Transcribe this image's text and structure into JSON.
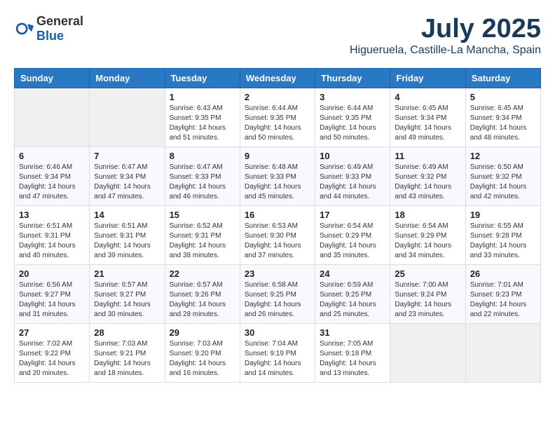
{
  "logo": {
    "text_general": "General",
    "text_blue": "Blue"
  },
  "header": {
    "month_year": "July 2025",
    "location": "Higueruela, Castille-La Mancha, Spain"
  },
  "weekdays": [
    "Sunday",
    "Monday",
    "Tuesday",
    "Wednesday",
    "Thursday",
    "Friday",
    "Saturday"
  ],
  "weeks": [
    [
      {
        "day": "",
        "sunrise": "",
        "sunset": "",
        "daylight": ""
      },
      {
        "day": "",
        "sunrise": "",
        "sunset": "",
        "daylight": ""
      },
      {
        "day": "1",
        "sunrise": "Sunrise: 6:43 AM",
        "sunset": "Sunset: 9:35 PM",
        "daylight": "Daylight: 14 hours and 51 minutes."
      },
      {
        "day": "2",
        "sunrise": "Sunrise: 6:44 AM",
        "sunset": "Sunset: 9:35 PM",
        "daylight": "Daylight: 14 hours and 50 minutes."
      },
      {
        "day": "3",
        "sunrise": "Sunrise: 6:44 AM",
        "sunset": "Sunset: 9:35 PM",
        "daylight": "Daylight: 14 hours and 50 minutes."
      },
      {
        "day": "4",
        "sunrise": "Sunrise: 6:45 AM",
        "sunset": "Sunset: 9:34 PM",
        "daylight": "Daylight: 14 hours and 49 minutes."
      },
      {
        "day": "5",
        "sunrise": "Sunrise: 6:45 AM",
        "sunset": "Sunset: 9:34 PM",
        "daylight": "Daylight: 14 hours and 48 minutes."
      }
    ],
    [
      {
        "day": "6",
        "sunrise": "Sunrise: 6:46 AM",
        "sunset": "Sunset: 9:34 PM",
        "daylight": "Daylight: 14 hours and 47 minutes."
      },
      {
        "day": "7",
        "sunrise": "Sunrise: 6:47 AM",
        "sunset": "Sunset: 9:34 PM",
        "daylight": "Daylight: 14 hours and 47 minutes."
      },
      {
        "day": "8",
        "sunrise": "Sunrise: 6:47 AM",
        "sunset": "Sunset: 9:33 PM",
        "daylight": "Daylight: 14 hours and 46 minutes."
      },
      {
        "day": "9",
        "sunrise": "Sunrise: 6:48 AM",
        "sunset": "Sunset: 9:33 PM",
        "daylight": "Daylight: 14 hours and 45 minutes."
      },
      {
        "day": "10",
        "sunrise": "Sunrise: 6:49 AM",
        "sunset": "Sunset: 9:33 PM",
        "daylight": "Daylight: 14 hours and 44 minutes."
      },
      {
        "day": "11",
        "sunrise": "Sunrise: 6:49 AM",
        "sunset": "Sunset: 9:32 PM",
        "daylight": "Daylight: 14 hours and 43 minutes."
      },
      {
        "day": "12",
        "sunrise": "Sunrise: 6:50 AM",
        "sunset": "Sunset: 9:32 PM",
        "daylight": "Daylight: 14 hours and 42 minutes."
      }
    ],
    [
      {
        "day": "13",
        "sunrise": "Sunrise: 6:51 AM",
        "sunset": "Sunset: 9:31 PM",
        "daylight": "Daylight: 14 hours and 40 minutes."
      },
      {
        "day": "14",
        "sunrise": "Sunrise: 6:51 AM",
        "sunset": "Sunset: 9:31 PM",
        "daylight": "Daylight: 14 hours and 39 minutes."
      },
      {
        "day": "15",
        "sunrise": "Sunrise: 6:52 AM",
        "sunset": "Sunset: 9:31 PM",
        "daylight": "Daylight: 14 hours and 38 minutes."
      },
      {
        "day": "16",
        "sunrise": "Sunrise: 6:53 AM",
        "sunset": "Sunset: 9:30 PM",
        "daylight": "Daylight: 14 hours and 37 minutes."
      },
      {
        "day": "17",
        "sunrise": "Sunrise: 6:54 AM",
        "sunset": "Sunset: 9:29 PM",
        "daylight": "Daylight: 14 hours and 35 minutes."
      },
      {
        "day": "18",
        "sunrise": "Sunrise: 6:54 AM",
        "sunset": "Sunset: 9:29 PM",
        "daylight": "Daylight: 14 hours and 34 minutes."
      },
      {
        "day": "19",
        "sunrise": "Sunrise: 6:55 AM",
        "sunset": "Sunset: 9:28 PM",
        "daylight": "Daylight: 14 hours and 33 minutes."
      }
    ],
    [
      {
        "day": "20",
        "sunrise": "Sunrise: 6:56 AM",
        "sunset": "Sunset: 9:27 PM",
        "daylight": "Daylight: 14 hours and 31 minutes."
      },
      {
        "day": "21",
        "sunrise": "Sunrise: 6:57 AM",
        "sunset": "Sunset: 9:27 PM",
        "daylight": "Daylight: 14 hours and 30 minutes."
      },
      {
        "day": "22",
        "sunrise": "Sunrise: 6:57 AM",
        "sunset": "Sunset: 9:26 PM",
        "daylight": "Daylight: 14 hours and 28 minutes."
      },
      {
        "day": "23",
        "sunrise": "Sunrise: 6:58 AM",
        "sunset": "Sunset: 9:25 PM",
        "daylight": "Daylight: 14 hours and 26 minutes."
      },
      {
        "day": "24",
        "sunrise": "Sunrise: 6:59 AM",
        "sunset": "Sunset: 9:25 PM",
        "daylight": "Daylight: 14 hours and 25 minutes."
      },
      {
        "day": "25",
        "sunrise": "Sunrise: 7:00 AM",
        "sunset": "Sunset: 9:24 PM",
        "daylight": "Daylight: 14 hours and 23 minutes."
      },
      {
        "day": "26",
        "sunrise": "Sunrise: 7:01 AM",
        "sunset": "Sunset: 9:23 PM",
        "daylight": "Daylight: 14 hours and 22 minutes."
      }
    ],
    [
      {
        "day": "27",
        "sunrise": "Sunrise: 7:02 AM",
        "sunset": "Sunset: 9:22 PM",
        "daylight": "Daylight: 14 hours and 20 minutes."
      },
      {
        "day": "28",
        "sunrise": "Sunrise: 7:03 AM",
        "sunset": "Sunset: 9:21 PM",
        "daylight": "Daylight: 14 hours and 18 minutes."
      },
      {
        "day": "29",
        "sunrise": "Sunrise: 7:03 AM",
        "sunset": "Sunset: 9:20 PM",
        "daylight": "Daylight: 14 hours and 16 minutes."
      },
      {
        "day": "30",
        "sunrise": "Sunrise: 7:04 AM",
        "sunset": "Sunset: 9:19 PM",
        "daylight": "Daylight: 14 hours and 14 minutes."
      },
      {
        "day": "31",
        "sunrise": "Sunrise: 7:05 AM",
        "sunset": "Sunset: 9:18 PM",
        "daylight": "Daylight: 14 hours and 13 minutes."
      },
      {
        "day": "",
        "sunrise": "",
        "sunset": "",
        "daylight": ""
      },
      {
        "day": "",
        "sunrise": "",
        "sunset": "",
        "daylight": ""
      }
    ]
  ]
}
